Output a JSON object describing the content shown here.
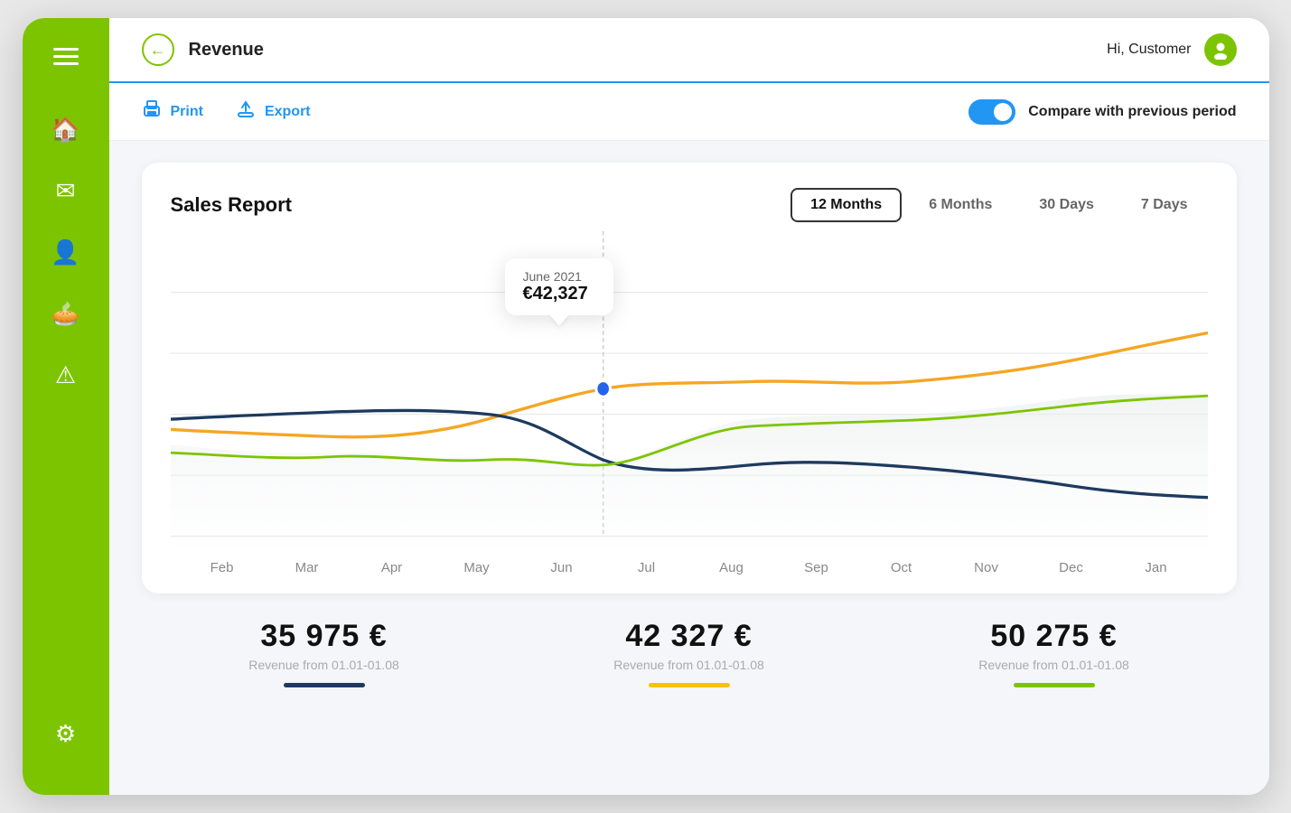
{
  "app": {
    "title": "Revenue"
  },
  "header": {
    "back_label": "←",
    "title": "Revenue",
    "greeting": "Hi, Customer"
  },
  "toolbar": {
    "print_label": "Print",
    "export_label": "Export",
    "compare_label": "Compare with previous period",
    "toggle_on": true
  },
  "chart_card": {
    "title": "Sales Report",
    "period_tabs": [
      {
        "label": "12 Months",
        "active": true
      },
      {
        "label": "6 Months",
        "active": false
      },
      {
        "label": "30 Days",
        "active": false
      },
      {
        "label": "7 Days",
        "active": false
      }
    ],
    "tooltip": {
      "date": "June 2021",
      "value": "€42,327"
    },
    "x_labels": [
      "Feb",
      "Mar",
      "Apr",
      "May",
      "Jun",
      "Jul",
      "Aug",
      "Sep",
      "Oct",
      "Nov",
      "Dec",
      "Jan"
    ]
  },
  "stats": [
    {
      "value": "35 975 €",
      "label": "Revenue from 01.01-01.08",
      "line_color": "dark"
    },
    {
      "value": "42 327 €",
      "label": "Revenue from 01.01-01.08",
      "line_color": "yellow"
    },
    {
      "value": "50 275 €",
      "label": "Revenue from 01.01-01.08",
      "line_color": "green"
    }
  ],
  "sidebar": {
    "items": [
      {
        "icon": "🏠",
        "name": "home",
        "active": false
      },
      {
        "icon": "✉",
        "name": "mail",
        "active": false
      },
      {
        "icon": "👤",
        "name": "user",
        "active": false
      },
      {
        "icon": "🥧",
        "name": "chart",
        "active": false
      },
      {
        "icon": "⚠",
        "name": "alert",
        "active": false
      }
    ],
    "bottom_item": {
      "icon": "⚙",
      "name": "settings"
    }
  }
}
